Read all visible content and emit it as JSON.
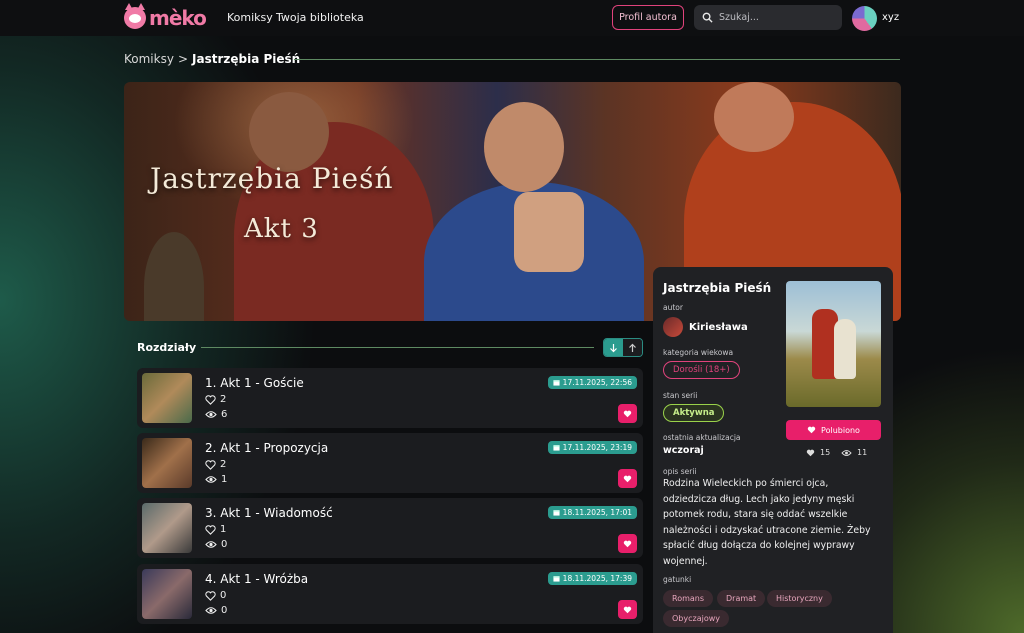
{
  "header": {
    "logo_text": "mèko",
    "nav": [
      "Komiksy",
      "Twoja biblioteka"
    ],
    "author_profile_button": "Profil autora",
    "search_placeholder": "Szukaj...",
    "username": "xyz"
  },
  "breadcrumb": {
    "parent": "Komiksy",
    "separator": ">",
    "current": "Jastrzębia Pieśń"
  },
  "banner": {
    "title_line1": "Jastrzębia Pieśń",
    "title_line2": "Akt 3"
  },
  "chapters": {
    "heading": "Rozdziały",
    "sort_desc_icon": "arrow-down-icon",
    "sort_asc_icon": "arrow-up-icon",
    "items": [
      {
        "title": "1. Akt 1 - Goście",
        "likes": "2",
        "views": "6",
        "date": "17.11.2025, 22:56"
      },
      {
        "title": "2. Akt 1 - Propozycja",
        "likes": "2",
        "views": "1",
        "date": "17.11.2025, 23:19"
      },
      {
        "title": "3. Akt 1 - Wiadomość",
        "likes": "1",
        "views": "0",
        "date": "18.11.2025, 17:01"
      },
      {
        "title": "4. Akt 1 - Wróżba",
        "likes": "0",
        "views": "0",
        "date": "18.11.2025, 17:39"
      }
    ]
  },
  "series": {
    "title": "Jastrzębia Pieśń",
    "author_label": "autor",
    "author": "Kiriesława",
    "age_label": "kategoria wiekowa",
    "age": "Dorośli (18+)",
    "status_label": "stan serii",
    "status": "Aktywna",
    "updated_label": "ostatnia aktualizacja",
    "updated": "wczoraj",
    "description_label": "opis serii",
    "description": "Rodzina Wieleckich po śmierci ojca, odziedzicza dług. Lech jako jedyny męski potomek rodu, stara się oddać wszelkie należności i odzyskać utracone ziemie. Żeby spłacić dług dołącza do kolejnej wyprawy wojennej.",
    "genres_label": "gatunki",
    "genres": [
      "Romans",
      "Dramat",
      "Historyczny",
      "Obyczajowy"
    ],
    "liked_button": "Polubiono",
    "likes_count": "15",
    "views_count": "11"
  },
  "colors": {
    "accent_pink": "#e81f6a",
    "accent_teal": "#2b9c8f",
    "status_green": "#9ad24a"
  }
}
